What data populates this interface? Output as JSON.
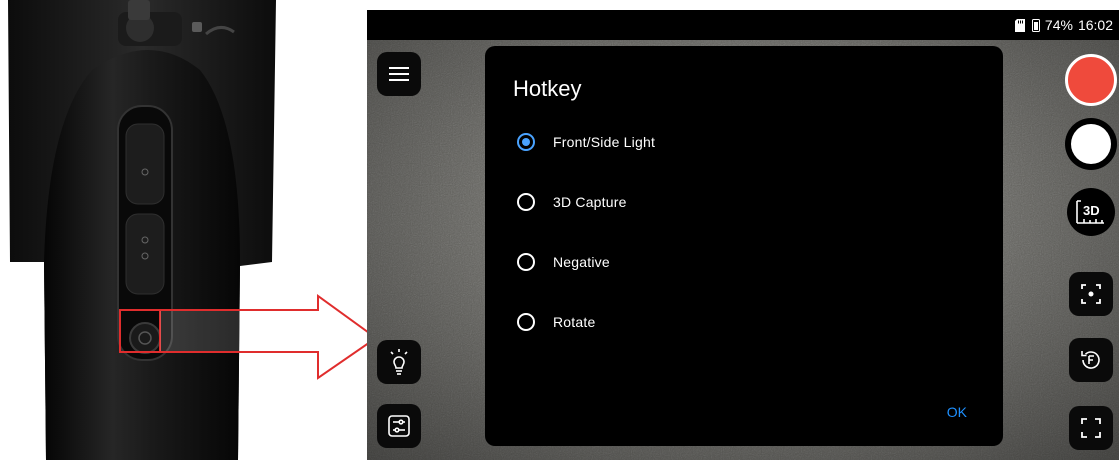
{
  "status_bar": {
    "battery_text": "74%",
    "time": "16:02"
  },
  "dialog": {
    "title": "Hotkey",
    "options": [
      {
        "label": "Front/Side Light",
        "selected": true
      },
      {
        "label": "3D Capture",
        "selected": false
      },
      {
        "label": "Negative",
        "selected": false
      },
      {
        "label": "Rotate",
        "selected": false
      }
    ],
    "ok_label": "OK"
  },
  "right_toolbar": {
    "threed_label": "3D"
  },
  "icons": {
    "menu": "menu-icon",
    "light": "bulb-icon",
    "settings": "sliders-icon",
    "record": "record-icon",
    "capture": "shutter-icon",
    "threed": "3d-measure-icon",
    "focus": "focus-icon",
    "flip": "flip-rotate-icon",
    "fullscreen": "fullscreen-icon"
  },
  "colors": {
    "record": "#ef4a3c",
    "radio_selected": "#4aa3ff",
    "ok": "#1e90ff",
    "callout": "#e02d2d"
  }
}
